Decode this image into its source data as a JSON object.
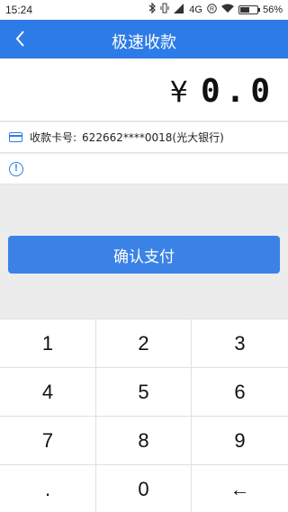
{
  "status_bar": {
    "time": "15:24",
    "network": "4G",
    "battery": "56%",
    "battery_level": 0.56
  },
  "header": {
    "title": "极速收款",
    "back_icon": "chevron-left-icon"
  },
  "amount": {
    "currency": "¥",
    "value": "0.0"
  },
  "card": {
    "label": "收款卡号:",
    "number": "622662****0018(光大银行)"
  },
  "notice": {
    "icon": "info-icon",
    "glyph": "!"
  },
  "confirm": {
    "label": "确认支付"
  },
  "keypad": {
    "keys": [
      "1",
      "2",
      "3",
      "4",
      "5",
      "6",
      "7",
      "8",
      "9",
      ".",
      "0",
      "←"
    ]
  },
  "colors": {
    "accent": "#2d7be7",
    "button": "#3b82e6",
    "background": "#ececec"
  }
}
